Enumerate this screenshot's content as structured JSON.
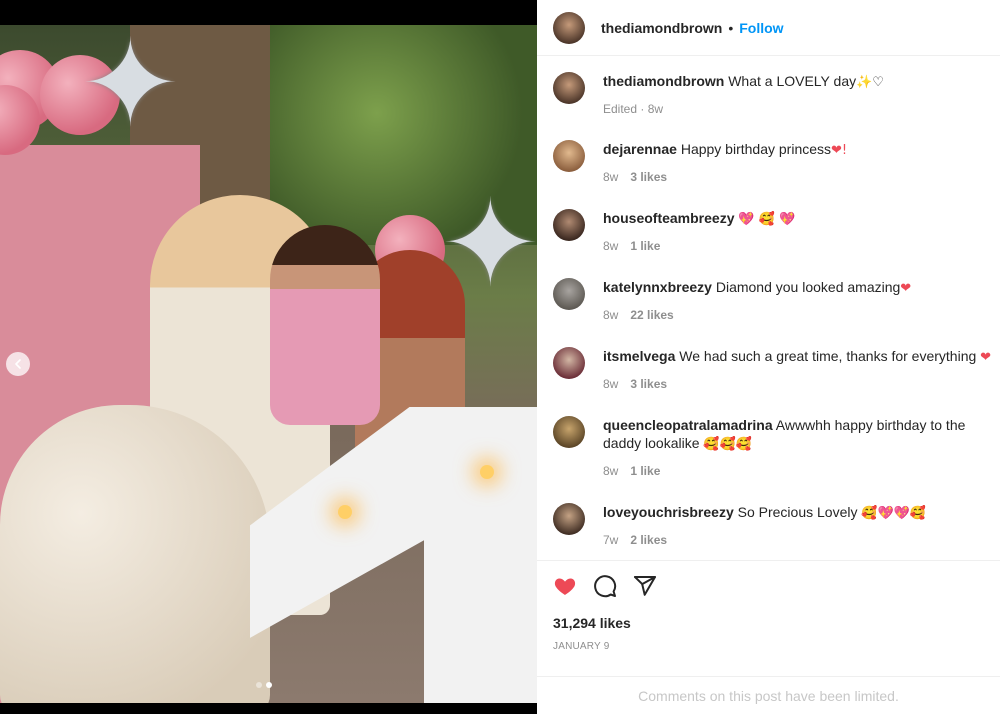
{
  "post": {
    "username": "thediamondbrown",
    "separator": "•",
    "follow_label": "Follow"
  },
  "caption": {
    "username": "thediamondbrown",
    "text": "What a LOVELY day",
    "emoji": "✨♡",
    "meta": "Edited · 8w"
  },
  "comments": [
    {
      "username": "dejarennae",
      "text": "Happy birthday princess",
      "emoji": "❤!",
      "time": "8w",
      "likes": "3 likes"
    },
    {
      "username": "houseofteambreezy",
      "text": "",
      "emoji": "💖 🥰 💖",
      "time": "8w",
      "likes": "1 like"
    },
    {
      "username": "katelynnxbreezy",
      "text": "Diamond you looked amazing",
      "emoji": "❤",
      "time": "8w",
      "likes": "22 likes"
    },
    {
      "username": "itsmelvega",
      "text": "We had such a great time, thanks for everything",
      "emoji": "❤",
      "time": "8w",
      "likes": "3 likes"
    },
    {
      "username": "queencleopatralamadrina",
      "text": "Awwwhh happy birthday to the daddy lookalike",
      "emoji": "🥰🥰🥰",
      "time": "8w",
      "likes": "1 like"
    },
    {
      "username": "loveyouchrisbreezy",
      "text": "So Precious Lovely",
      "emoji": "🥰💖💖🥰",
      "time": "7w",
      "likes": "2 likes"
    }
  ],
  "actions": {
    "likes_count": "31,294 likes",
    "date": "JANUARY 9"
  },
  "footer": {
    "limited_text": "Comments on this post have been limited."
  },
  "colors": {
    "follow": "#0095f6",
    "liked_heart": "#ed4956"
  },
  "carousel": {
    "current_slide": 2,
    "total_slides": 2
  }
}
